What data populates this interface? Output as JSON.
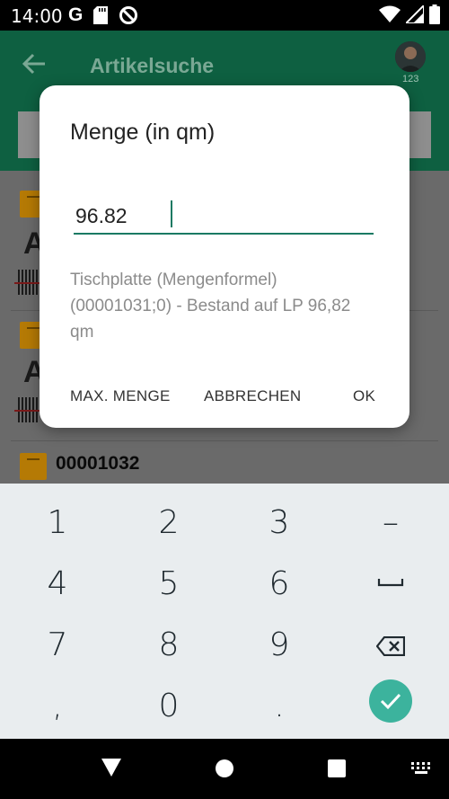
{
  "status_bar": {
    "time": "14:00",
    "g_label": "G",
    "icons_left": [
      "google-icon",
      "sd-card-icon",
      "data-saver-icon"
    ],
    "icons_right": [
      "wifi-icon",
      "signal-icon",
      "battery-icon"
    ]
  },
  "app_bar": {
    "title": "Artikelsuche",
    "avatar_badge": "123"
  },
  "list": {
    "item_number": "00001032",
    "big_letter": "A"
  },
  "dialog": {
    "title": "Menge (in qm)",
    "input_value": "96.82",
    "message": "Tischplatte (Mengenformel) (00001031;0) - Bestand auf LP 96,82 qm",
    "btn_max": "MAX. MENGE",
    "btn_cancel": "ABBRECHEN",
    "btn_ok": "OK"
  },
  "keyboard": {
    "keys": [
      "1",
      "2",
      "3",
      "–",
      "4",
      "5",
      "6",
      "7",
      "8",
      "9",
      ",",
      "0",
      "."
    ]
  },
  "colors": {
    "primary": "#0e6041",
    "accent": "#1a7a63",
    "enter_key": "#3cb39d",
    "box_icon": "#b57a05"
  }
}
